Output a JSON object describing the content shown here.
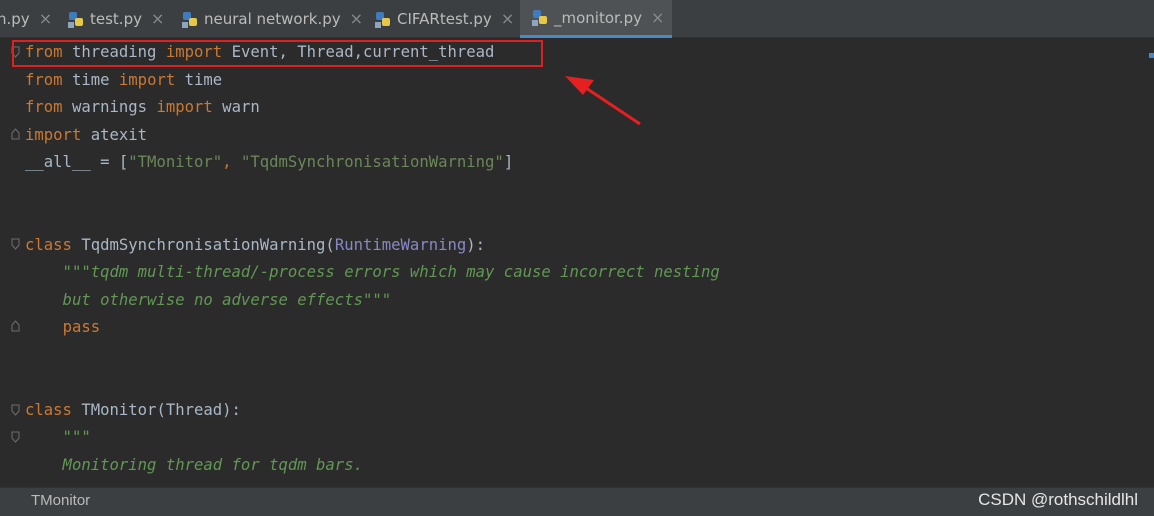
{
  "tabs": [
    {
      "label": "n.py",
      "icon": "python-file-icon",
      "active": false
    },
    {
      "label": "test.py",
      "icon": "python-file-icon",
      "active": false
    },
    {
      "label": "neural network.py",
      "icon": "python-file-icon",
      "active": false
    },
    {
      "label": "CIFARtest.py",
      "icon": "python-file-icon",
      "active": false
    },
    {
      "label": "_monitor.py",
      "icon": "python-file-icon",
      "active": true
    }
  ],
  "tab_close_glyph": "×",
  "code": {
    "l1": {
      "from": "from",
      "mod": " threading ",
      "imp": "import",
      "rest": " Event, Thread,current_thread"
    },
    "l2": {
      "from": "from",
      "mod": " time ",
      "imp": "import",
      "rest": " time"
    },
    "l3": {
      "from": "from",
      "mod": " warnings ",
      "imp": "import",
      "rest": " warn"
    },
    "l4": {
      "imp": "import",
      "rest": " atexit"
    },
    "l5": {
      "pre": "__all__ = [",
      "s1": "\"TMonitor\"",
      "comma": ", ",
      "s2": "\"TqdmSynchronisationWarning\"",
      "post": "]"
    },
    "l6": {
      "kw": "class",
      "name": " TqdmSynchronisationWarning(",
      "base": "RuntimeWarning",
      "post": "):"
    },
    "l7": {
      "doc": "    \"\"\"tqdm multi-thread/-process errors which may cause incorrect nesting"
    },
    "l8": {
      "doc": "    but otherwise no adverse effects\"\"\""
    },
    "l9": {
      "indent": "    ",
      "kw": "pass"
    },
    "l10": {
      "kw": "class",
      "name": " TMonitor(Thread):"
    },
    "l11": {
      "doc": "    \"\"\""
    },
    "l12": {
      "doc": "    Monitoring thread for tqdm bars."
    }
  },
  "status": {
    "breadcrumb": "TMonitor"
  },
  "watermark": "CSDN @rothschildlhl",
  "colors": {
    "keyword": "#cc7832",
    "string": "#6a8759",
    "docstring": "#629755",
    "builtin": "#8888c6",
    "default": "#a9b7c6",
    "highlight": "#e02020",
    "accent": "#4a88c7"
  }
}
